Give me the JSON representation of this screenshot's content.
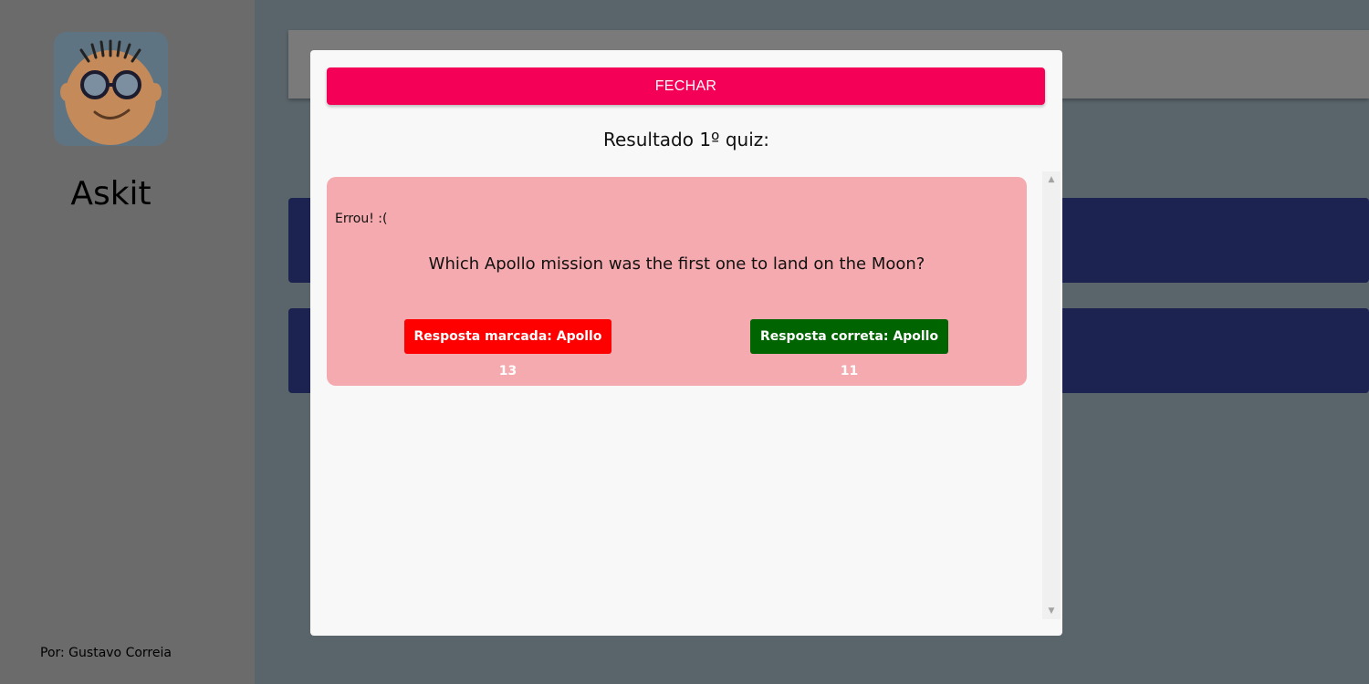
{
  "app": {
    "name": "Askit",
    "author": "Por: Gustavo Correia",
    "logo_icon": "nerd-face-logo"
  },
  "modal": {
    "close_label": "FECHAR",
    "title": "Resultado 1º quiz:",
    "results": [
      {
        "status": "Errou! :(",
        "question": "Which Apollo mission was the first one to land on the Moon?",
        "marked_answer": "Resposta marcada: Apollo 13",
        "correct_answer": "Resposta correta: Apollo 11"
      }
    ]
  },
  "colors": {
    "close_button": "#f50057",
    "wrong_card": "#f4aaae",
    "marked_answer": "#ff0000",
    "correct_answer": "#006400",
    "background_card": "#1c2350"
  }
}
